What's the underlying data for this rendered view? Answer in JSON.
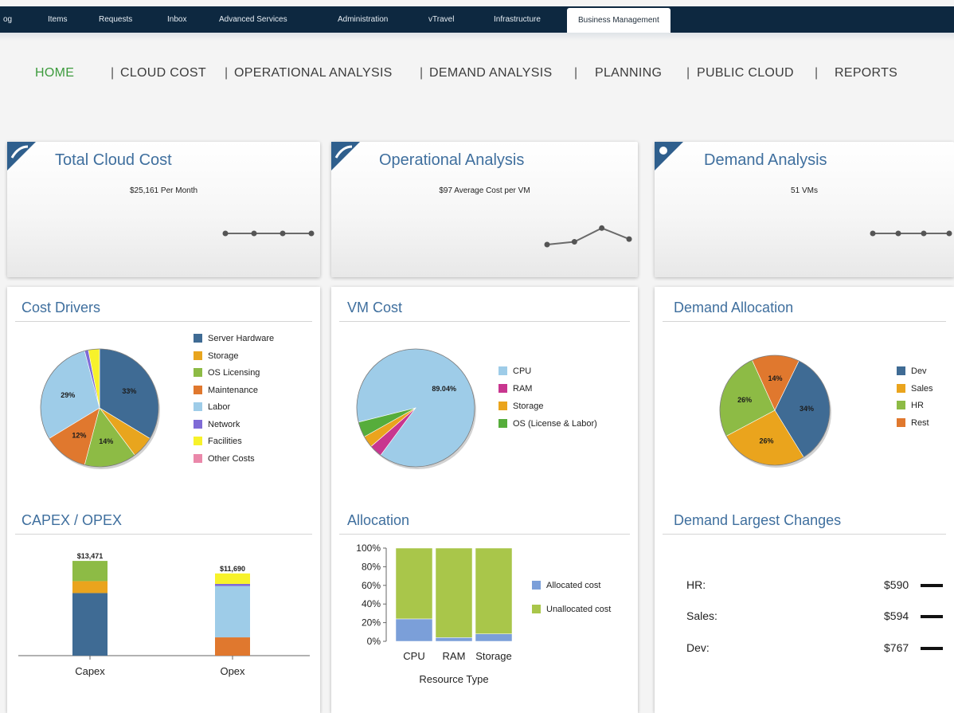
{
  "top_tabs": [
    {
      "label": "og",
      "active": false
    },
    {
      "label": "Items",
      "active": false
    },
    {
      "label": "Requests",
      "active": false
    },
    {
      "label": "Inbox",
      "active": false
    },
    {
      "label": "Advanced Services",
      "active": false
    },
    {
      "label": "Administration",
      "active": false
    },
    {
      "label": "vTravel",
      "active": false
    },
    {
      "label": "Infrastructure",
      "active": false
    },
    {
      "label": "Business Management",
      "active": true
    }
  ],
  "sub_nav": {
    "items": [
      "HOME",
      "CLOUD COST",
      "OPERATIONAL ANALYSIS",
      "DEMAND ANALYSIS",
      "PLANNING",
      "PUBLIC CLOUD",
      "REPORTS"
    ],
    "active": "HOME",
    "separator": "|"
  },
  "kpis": [
    {
      "title": "Total Cloud Cost",
      "subtitle": "$25,161 Per Month",
      "spark": [
        1,
        1,
        1,
        1
      ]
    },
    {
      "title": "Operational Analysis",
      "subtitle": "$97 Average Cost per VM",
      "spark": [
        0,
        0.15,
        0.9,
        0.3
      ]
    },
    {
      "title": "Demand Analysis",
      "subtitle": "51 VMs",
      "spark": [
        1,
        1,
        1,
        1
      ]
    }
  ],
  "panels": {
    "cost_drivers": {
      "title": "Cost Drivers"
    },
    "vm_cost": {
      "title": "VM Cost"
    },
    "demand_allocation": {
      "title": "Demand Allocation"
    },
    "capex_opex": {
      "title": "CAPEX / OPEX"
    },
    "allocation": {
      "title": "Allocation"
    },
    "demand_changes": {
      "title": "Demand Largest Changes",
      "rows": [
        {
          "label": "HR:",
          "value": "$590"
        },
        {
          "label": "Sales:",
          "value": "$594"
        },
        {
          "label": "Dev:",
          "value": "$767"
        }
      ]
    }
  },
  "colors": {
    "accent": "#3f6f9e",
    "active_nav": "#3d9b3d",
    "topbar": "#0d2840"
  },
  "chart_data": [
    {
      "id": "cost_drivers",
      "type": "pie",
      "categories": [
        "Server Hardware",
        "Storage",
        "OS Licensing",
        "Maintenance",
        "Labor",
        "Network",
        "Facilities",
        "Other Costs"
      ],
      "values": [
        33,
        6,
        14,
        12,
        29,
        1,
        3,
        0
      ],
      "data_labels": [
        "33%",
        "",
        "14%",
        "12%",
        "29%",
        "",
        "",
        ""
      ],
      "colors": [
        "#3f6b94",
        "#e8a51e",
        "#8dbb45",
        "#e0782e",
        "#9ecce8",
        "#7f6bd6",
        "#f7f22a",
        "#ea88aa"
      ],
      "legend": "right"
    },
    {
      "id": "vm_cost",
      "type": "pie",
      "categories": [
        "CPU",
        "RAM",
        "Storage",
        "OS (License & Labor)"
      ],
      "values": [
        89.04,
        3.5,
        3.2,
        4.26
      ],
      "data_labels": [
        "89.04%",
        "",
        "",
        ""
      ],
      "colors": [
        "#9ecce8",
        "#c8368f",
        "#eaa41d",
        "#56ad3b"
      ],
      "legend": "right"
    },
    {
      "id": "demand_allocation",
      "type": "pie",
      "categories": [
        "Dev",
        "Sales",
        "HR",
        "Rest"
      ],
      "values": [
        34,
        26,
        26,
        14
      ],
      "data_labels": [
        "34%",
        "26%",
        "26%",
        "14%"
      ],
      "colors": [
        "#3f6b94",
        "#eaa41d",
        "#8dbb45",
        "#e0782e"
      ],
      "legend": "right"
    },
    {
      "id": "capex_opex",
      "type": "bar",
      "stacked": true,
      "categories": [
        "Capex",
        "Opex"
      ],
      "totals": [
        "$13,471",
        "$11,690"
      ],
      "series": [
        {
          "values": [
            8900,
            0
          ],
          "color": "#3f6b94"
        },
        {
          "values": [
            1700,
            0
          ],
          "color": "#eaa41d"
        },
        {
          "values": [
            2871,
            0
          ],
          "color": "#8dbb45"
        },
        {
          "values": [
            0,
            2600
          ],
          "color": "#e0782e"
        },
        {
          "values": [
            0,
            7300
          ],
          "color": "#9ecce8"
        },
        {
          "values": [
            0,
            300
          ],
          "color": "#7f6bd6"
        },
        {
          "values": [
            0,
            1490
          ],
          "color": "#f7f22a"
        }
      ],
      "ylim": [
        0,
        14500
      ]
    },
    {
      "id": "allocation",
      "type": "bar",
      "stacked": true,
      "categories": [
        "CPU",
        "RAM",
        "Storage"
      ],
      "xlabel": "Resource Type",
      "yticks": [
        "0%",
        "20%",
        "40%",
        "60%",
        "80%",
        "100%"
      ],
      "ylim": [
        0,
        100
      ],
      "series": [
        {
          "name": "Allocated cost",
          "values": [
            24,
            4,
            8
          ],
          "color": "#7b9fd9"
        },
        {
          "name": "Unallocated cost",
          "values": [
            76,
            96,
            92
          ],
          "color": "#a9c64a"
        }
      ],
      "legend": "right"
    }
  ]
}
